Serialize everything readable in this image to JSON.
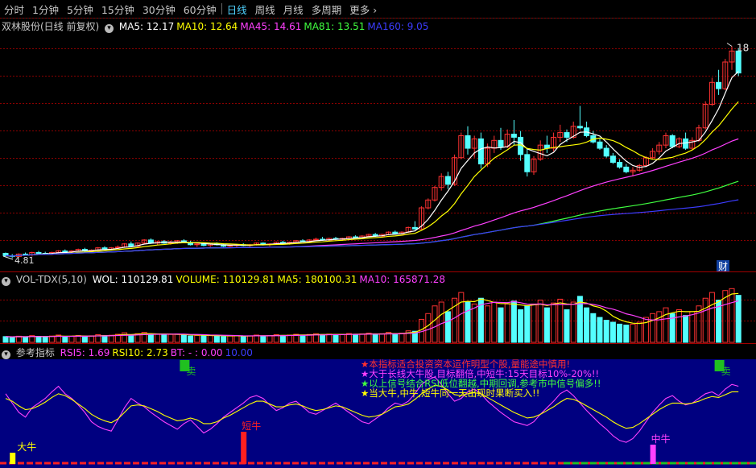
{
  "toolbar": {
    "items": [
      {
        "label": "分时",
        "active": false
      },
      {
        "label": "1分钟",
        "active": false
      },
      {
        "label": "5分钟",
        "active": false
      },
      {
        "label": "15分钟",
        "active": false
      },
      {
        "label": "30分钟",
        "active": false
      },
      {
        "label": "60分钟",
        "active": false
      },
      {
        "label": "日线",
        "active": true
      },
      {
        "label": "周线",
        "active": false
      },
      {
        "label": "月线",
        "active": false
      },
      {
        "label": "多周期",
        "active": false
      },
      {
        "label": "更多",
        "active": false
      }
    ],
    "more_icon": "chevron-right-icon"
  },
  "main_panel": {
    "stock_name": "双林股份(日线 前复权)",
    "indicators": [
      {
        "label": "MA5: 12.17",
        "color": "#ffffff"
      },
      {
        "label": "MA10: 12.64",
        "color": "#ffff00"
      },
      {
        "label": "MA45: 14.61",
        "color": "#ff40ff"
      },
      {
        "label": "MA81: 13.51",
        "color": "#40ff40"
      },
      {
        "label": "MA160: 9.05",
        "color": "#3c3cff"
      }
    ],
    "high_label": "18",
    "low_label": "4.81",
    "badge": "财"
  },
  "volume_panel": {
    "name": "VOL-TDX(5,10)",
    "indicators": [
      {
        "label": "WOL: 110129.81",
        "color": "#ffffff"
      },
      {
        "label": "VOLUME: 110129.81",
        "color": "#ffff00"
      },
      {
        "label": "MA5: 180100.31",
        "color": "#ffff00"
      },
      {
        "label": "MA10: 165871.28",
        "color": "#ff40ff"
      }
    ]
  },
  "rsi_panel": {
    "name": "参考指标",
    "indicators": [
      {
        "label": "RSI5: 1.69",
        "color": "#ff40ff"
      },
      {
        "label": "RSI10: 2.73",
        "color": "#ffff00"
      },
      {
        "label": "BT: - : 0.00",
        "color": "#ff40ff"
      },
      {
        "label": "10.00",
        "color": "#3c3cff"
      }
    ],
    "notes": [
      {
        "text": "★本指标适合投资资本运作明型个股,量能途中慎用!",
        "color": "#ff3030"
      },
      {
        "text": "★大于长线大牛股,目标翻倍,中短牛:15天目标10%-20%!!",
        "color": "#ff40ff"
      },
      {
        "text": "★以上信号结合RSI低位翻越,中期回调,参考市中信号偏多!!",
        "color": "#40ff40"
      },
      {
        "text": "★当大牛,中牛,短牛同一天出现时果断买入!!",
        "color": "#ffff00"
      }
    ],
    "signals": [
      {
        "label": "卖",
        "color": "#20c020"
      },
      {
        "label": "卖",
        "color": "#20c020"
      },
      {
        "label": "大牛",
        "color": "#ffff00"
      },
      {
        "label": "短牛",
        "color": "#ff2020"
      },
      {
        "label": "中牛",
        "color": "#ff40ff"
      }
    ]
  },
  "colors": {
    "up": "#ff3232",
    "down": "#54ffff",
    "grid": "#8a0000",
    "rsi_bg": "#000080"
  },
  "chart_data": [
    {
      "type": "candlestick",
      "title": "双林股份(日线 前复权)",
      "ylim": [
        4.0,
        19.0
      ],
      "candles": [
        [
          4.9,
          4.95,
          4.7,
          4.75
        ],
        [
          4.75,
          4.85,
          4.6,
          4.7
        ],
        [
          4.7,
          4.9,
          4.65,
          4.85
        ],
        [
          4.85,
          4.95,
          4.75,
          4.8
        ],
        [
          4.8,
          5.0,
          4.7,
          4.95
        ],
        [
          4.95,
          5.05,
          4.85,
          4.9
        ],
        [
          4.9,
          5.0,
          4.8,
          4.85
        ],
        [
          4.85,
          5.0,
          4.8,
          4.95
        ],
        [
          4.95,
          5.1,
          4.9,
          5.05
        ],
        [
          5.05,
          5.15,
          4.95,
          5.0
        ],
        [
          5.0,
          5.1,
          4.9,
          5.05
        ],
        [
          5.05,
          5.2,
          5.0,
          5.15
        ],
        [
          5.15,
          5.25,
          5.0,
          5.05
        ],
        [
          5.05,
          5.15,
          4.95,
          5.1
        ],
        [
          5.1,
          5.3,
          5.05,
          5.25
        ],
        [
          5.25,
          5.35,
          5.1,
          5.15
        ],
        [
          5.15,
          5.3,
          5.1,
          5.25
        ],
        [
          5.25,
          5.4,
          5.2,
          5.3
        ],
        [
          5.3,
          5.55,
          5.25,
          5.5
        ],
        [
          5.5,
          5.65,
          5.3,
          5.35
        ],
        [
          5.35,
          5.6,
          5.3,
          5.55
        ],
        [
          5.55,
          5.8,
          5.5,
          5.75
        ],
        [
          5.75,
          5.85,
          5.5,
          5.55
        ],
        [
          5.55,
          5.7,
          5.45,
          5.65
        ],
        [
          5.65,
          5.75,
          5.5,
          5.55
        ],
        [
          5.55,
          5.7,
          5.45,
          5.6
        ],
        [
          5.6,
          5.75,
          5.5,
          5.7
        ],
        [
          5.7,
          5.8,
          5.55,
          5.6
        ],
        [
          5.6,
          5.7,
          5.4,
          5.45
        ],
        [
          5.45,
          5.55,
          5.3,
          5.5
        ],
        [
          5.5,
          5.6,
          5.35,
          5.4
        ],
        [
          5.4,
          5.55,
          5.3,
          5.5
        ],
        [
          5.5,
          5.6,
          5.4,
          5.45
        ],
        [
          5.45,
          5.5,
          5.3,
          5.35
        ],
        [
          5.35,
          5.45,
          5.25,
          5.4
        ],
        [
          5.4,
          5.5,
          5.3,
          5.45
        ],
        [
          5.45,
          5.55,
          5.35,
          5.4
        ],
        [
          5.4,
          5.5,
          5.3,
          5.45
        ],
        [
          5.45,
          5.6,
          5.4,
          5.55
        ],
        [
          5.55,
          5.6,
          5.4,
          5.45
        ],
        [
          5.45,
          5.55,
          5.35,
          5.5
        ],
        [
          5.5,
          5.65,
          5.45,
          5.6
        ],
        [
          5.6,
          5.7,
          5.5,
          5.55
        ],
        [
          5.55,
          5.65,
          5.45,
          5.6
        ],
        [
          5.6,
          5.75,
          5.55,
          5.7
        ],
        [
          5.7,
          5.8,
          5.6,
          5.65
        ],
        [
          5.65,
          5.8,
          5.6,
          5.75
        ],
        [
          5.75,
          5.9,
          5.7,
          5.8
        ],
        [
          5.8,
          5.95,
          5.7,
          5.75
        ],
        [
          5.75,
          5.9,
          5.7,
          5.85
        ],
        [
          5.85,
          5.95,
          5.75,
          5.8
        ],
        [
          5.8,
          5.9,
          5.7,
          5.85
        ],
        [
          5.85,
          6.0,
          5.8,
          5.95
        ],
        [
          5.95,
          6.05,
          5.85,
          5.9
        ],
        [
          5.9,
          6.05,
          5.85,
          6.0
        ],
        [
          6.0,
          6.15,
          5.95,
          6.1
        ],
        [
          6.1,
          6.2,
          5.95,
          6.0
        ],
        [
          6.0,
          6.15,
          5.95,
          6.1
        ],
        [
          6.1,
          6.3,
          6.05,
          6.25
        ],
        [
          6.25,
          6.35,
          6.1,
          6.15
        ],
        [
          6.15,
          6.3,
          6.1,
          6.25
        ],
        [
          6.25,
          6.6,
          6.2,
          6.55
        ],
        [
          6.55,
          6.95,
          6.4,
          6.45
        ],
        [
          6.45,
          7.9,
          6.4,
          7.8
        ],
        [
          7.8,
          8.4,
          7.7,
          8.3
        ],
        [
          8.3,
          9.2,
          8.2,
          9.1
        ],
        [
          9.1,
          10.0,
          8.9,
          9.8
        ],
        [
          9.8,
          10.1,
          9.0,
          9.3
        ],
        [
          9.3,
          11.2,
          9.2,
          11.0
        ],
        [
          11.0,
          12.6,
          10.9,
          12.4
        ],
        [
          12.4,
          13.0,
          11.2,
          11.6
        ],
        [
          11.6,
          12.4,
          11.0,
          12.2
        ],
        [
          12.2,
          12.6,
          10.3,
          10.6
        ],
        [
          10.6,
          11.9,
          10.4,
          11.6
        ],
        [
          11.6,
          12.4,
          11.3,
          12.1
        ],
        [
          12.1,
          12.9,
          11.5,
          11.7
        ],
        [
          11.7,
          12.8,
          11.6,
          12.5
        ],
        [
          12.5,
          13.4,
          11.8,
          12.3
        ],
        [
          12.3,
          12.7,
          10.8,
          11.2
        ],
        [
          11.2,
          11.6,
          9.8,
          10.1
        ],
        [
          10.1,
          11.1,
          9.9,
          10.9
        ],
        [
          10.9,
          12.1,
          10.8,
          11.8
        ],
        [
          11.8,
          12.4,
          11.3,
          11.6
        ],
        [
          11.6,
          12.6,
          11.4,
          12.3
        ],
        [
          12.3,
          13.1,
          12.0,
          12.6
        ],
        [
          12.6,
          12.8,
          12.0,
          12.3
        ],
        [
          12.3,
          13.3,
          12.2,
          13.0
        ],
        [
          13.0,
          14.3,
          12.8,
          12.9
        ],
        [
          12.9,
          13.3,
          12.3,
          12.4
        ],
        [
          12.4,
          12.7,
          11.9,
          12.0
        ],
        [
          12.0,
          12.2,
          11.5,
          11.6
        ],
        [
          11.6,
          11.8,
          11.0,
          11.1
        ],
        [
          11.1,
          11.3,
          10.6,
          10.7
        ],
        [
          10.7,
          10.9,
          10.3,
          10.4
        ],
        [
          10.4,
          10.6,
          10.0,
          10.1
        ],
        [
          10.1,
          10.4,
          9.8,
          10.2
        ],
        [
          10.2,
          10.6,
          10.1,
          10.5
        ],
        [
          10.5,
          11.1,
          10.4,
          11.0
        ],
        [
          11.0,
          11.6,
          10.9,
          11.4
        ],
        [
          11.4,
          12.0,
          11.2,
          11.8
        ],
        [
          11.8,
          12.6,
          11.6,
          12.4
        ],
        [
          12.4,
          12.5,
          11.6,
          11.7
        ],
        [
          11.7,
          12.3,
          11.6,
          12.2
        ],
        [
          12.2,
          12.6,
          11.5,
          11.6
        ],
        [
          11.6,
          12.3,
          11.5,
          12.1
        ],
        [
          12.1,
          13.1,
          12.0,
          12.9
        ],
        [
          12.9,
          14.6,
          12.8,
          14.4
        ],
        [
          14.4,
          16.1,
          14.3,
          15.8
        ],
        [
          15.8,
          16.6,
          15.0,
          15.4
        ],
        [
          15.4,
          17.3,
          15.3,
          17.1
        ],
        [
          17.1,
          18.1,
          16.6,
          17.8
        ],
        [
          17.8,
          18.0,
          16.2,
          16.4
        ]
      ],
      "ma_periods": [
        5,
        10,
        45,
        81,
        160
      ]
    },
    {
      "type": "bar",
      "title": "VOL-TDX(5,10)",
      "values": [
        30,
        28,
        32,
        27,
        35,
        31,
        29,
        33,
        38,
        30,
        32,
        36,
        30,
        34,
        40,
        35,
        37,
        42,
        50,
        38,
        45,
        52,
        40,
        43,
        39,
        41,
        44,
        38,
        33,
        36,
        34,
        37,
        35,
        30,
        33,
        35,
        32,
        34,
        38,
        33,
        35,
        40,
        36,
        38,
        42,
        37,
        41,
        45,
        39,
        43,
        40,
        41,
        46,
        42,
        44,
        48,
        40,
        45,
        52,
        44,
        48,
        60,
        58,
        120,
        150,
        190,
        210,
        160,
        230,
        260,
        210,
        200,
        230,
        190,
        210,
        180,
        200,
        215,
        170,
        190,
        200,
        220,
        180,
        205,
        225,
        170,
        210,
        240,
        180,
        150,
        130,
        115,
        105,
        95,
        90,
        95,
        105,
        130,
        150,
        160,
        180,
        150,
        170,
        140,
        160,
        190,
        230,
        260,
        220,
        270,
        280,
        245
      ],
      "ma_periods": [
        5,
        10
      ]
    },
    {
      "type": "line",
      "title": "参考指标",
      "ylim": [
        0,
        100
      ],
      "series": [
        {
          "name": "RSI5",
          "values": [
            70,
            60,
            50,
            45,
            55,
            60,
            65,
            72,
            78,
            70,
            65,
            58,
            50,
            40,
            35,
            32,
            30,
            42,
            55,
            65,
            60,
            56,
            50,
            45,
            40,
            36,
            32,
            38,
            42,
            35,
            28,
            32,
            38,
            45,
            50,
            55,
            60,
            66,
            68,
            65,
            58,
            52,
            55,
            60,
            62,
            56,
            50,
            48,
            52,
            56,
            60,
            55,
            50,
            45,
            40,
            38,
            43,
            48,
            55,
            60,
            58,
            62,
            70,
            80,
            85,
            88,
            80,
            70,
            62,
            65,
            72,
            75,
            70,
            62,
            56,
            50,
            45,
            40,
            38,
            36,
            40,
            48,
            55,
            62,
            70,
            74,
            68,
            60,
            52,
            45,
            38,
            32,
            25,
            20,
            18,
            22,
            30,
            40,
            50,
            58,
            65,
            68,
            62,
            58,
            60,
            65,
            70,
            72,
            68,
            75,
            80,
            78
          ]
        },
        {
          "name": "RSI10",
          "values": [
            65,
            62,
            57,
            53,
            54,
            57,
            61,
            66,
            70,
            68,
            64,
            59,
            54,
            48,
            44,
            41,
            39,
            43,
            50,
            57,
            58,
            57,
            54,
            51,
            47,
            44,
            41,
            42,
            44,
            42,
            38,
            38,
            40,
            44,
            47,
            51,
            55,
            59,
            62,
            62,
            59,
            56,
            56,
            58,
            59,
            57,
            54,
            52,
            53,
            55,
            57,
            56,
            53,
            50,
            47,
            45,
            46,
            48,
            52,
            56,
            57,
            59,
            64,
            70,
            75,
            79,
            78,
            74,
            69,
            68,
            70,
            71,
            70,
            66,
            62,
            58,
            54,
            50,
            47,
            44,
            45,
            48,
            52,
            56,
            61,
            65,
            64,
            61,
            57,
            53,
            49,
            45,
            40,
            36,
            33,
            34,
            38,
            43,
            48,
            53,
            57,
            60,
            60,
            59,
            60,
            62,
            65,
            67,
            66,
            69,
            72,
            72
          ]
        }
      ],
      "signals": [
        {
          "index": 27,
          "type": "卖"
        },
        {
          "index": 108,
          "type": "卖"
        },
        {
          "index": 1,
          "type": "大牛"
        },
        {
          "index": 36,
          "type": "短牛"
        },
        {
          "index": 98,
          "type": "中牛"
        }
      ]
    }
  ]
}
